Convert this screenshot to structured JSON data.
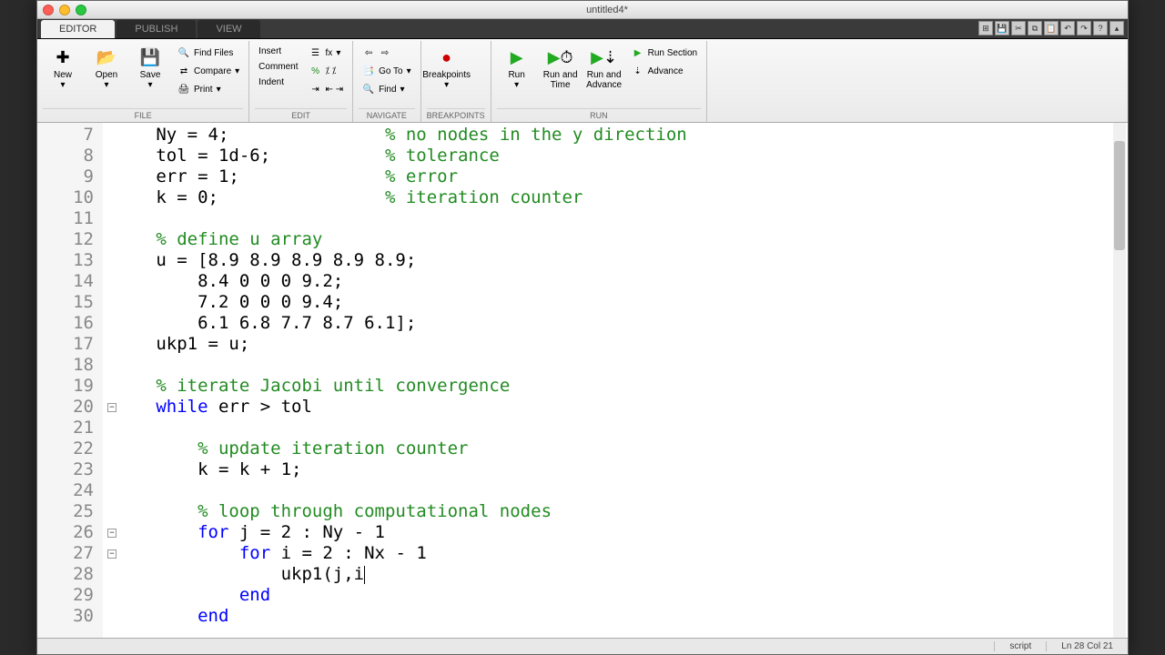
{
  "window": {
    "title": "untitled4*"
  },
  "tabs": {
    "editor": "EDITOR",
    "publish": "PUBLISH",
    "view": "VIEW"
  },
  "ribbon": {
    "file": {
      "label": "FILE",
      "new": "New",
      "open": "Open",
      "save": "Save",
      "find_files": "Find Files",
      "compare": "Compare",
      "print": "Print"
    },
    "edit": {
      "label": "EDIT",
      "insert": "Insert",
      "comment": "Comment",
      "indent": "Indent",
      "fx": "fx"
    },
    "nav": {
      "label": "NAVIGATE",
      "goto": "Go To",
      "find": "Find"
    },
    "bp": {
      "label": "BREAKPOINTS",
      "breakpoints": "Breakpoints"
    },
    "run": {
      "label": "RUN",
      "run": "Run",
      "run_time": "Run and Time",
      "run_adv": "Run and Advance",
      "run_section": "Run Section",
      "advance": "Advance"
    }
  },
  "code_lines": [
    {
      "n": 7,
      "segs": [
        [
          "txt",
          "   Ny = 4;               "
        ],
        [
          "cm",
          "% no nodes in the y direction"
        ]
      ]
    },
    {
      "n": 8,
      "segs": [
        [
          "txt",
          "   tol = 1d-6;           "
        ],
        [
          "cm",
          "% tolerance"
        ]
      ]
    },
    {
      "n": 9,
      "segs": [
        [
          "txt",
          "   err = 1;              "
        ],
        [
          "cm",
          "% error"
        ]
      ]
    },
    {
      "n": 10,
      "segs": [
        [
          "txt",
          "   k = 0;                "
        ],
        [
          "cm",
          "% iteration counter"
        ]
      ]
    },
    {
      "n": 11,
      "segs": []
    },
    {
      "n": 12,
      "segs": [
        [
          "txt",
          "   "
        ],
        [
          "cm",
          "% define u array"
        ]
      ]
    },
    {
      "n": 13,
      "segs": [
        [
          "txt",
          "   u = [8.9 8.9 8.9 8.9 8.9;"
        ]
      ]
    },
    {
      "n": 14,
      "segs": [
        [
          "txt",
          "       8.4 0 0 0 9.2;"
        ]
      ]
    },
    {
      "n": 15,
      "segs": [
        [
          "txt",
          "       7.2 0 0 0 9.4;"
        ]
      ]
    },
    {
      "n": 16,
      "segs": [
        [
          "txt",
          "       6.1 6.8 7.7 8.7 6.1];"
        ]
      ]
    },
    {
      "n": 17,
      "segs": [
        [
          "txt",
          "   ukp1 = u;"
        ]
      ]
    },
    {
      "n": 18,
      "segs": []
    },
    {
      "n": 19,
      "segs": [
        [
          "txt",
          "   "
        ],
        [
          "cm",
          "% iterate Jacobi until convergence"
        ]
      ]
    },
    {
      "n": 20,
      "fold": "-",
      "segs": [
        [
          "txt",
          "   "
        ],
        [
          "kw",
          "while"
        ],
        [
          "txt",
          " err > tol"
        ]
      ]
    },
    {
      "n": 21,
      "segs": []
    },
    {
      "n": 22,
      "segs": [
        [
          "txt",
          "       "
        ],
        [
          "cm",
          "% update iteration counter"
        ]
      ]
    },
    {
      "n": 23,
      "segs": [
        [
          "txt",
          "       k = k + 1;"
        ]
      ]
    },
    {
      "n": 24,
      "segs": []
    },
    {
      "n": 25,
      "segs": [
        [
          "txt",
          "       "
        ],
        [
          "cm",
          "% loop through computational nodes"
        ]
      ]
    },
    {
      "n": 26,
      "fold": "-",
      "segs": [
        [
          "txt",
          "       "
        ],
        [
          "kw",
          "for"
        ],
        [
          "txt",
          " j = 2 : Ny - 1"
        ]
      ]
    },
    {
      "n": 27,
      "fold": "-",
      "segs": [
        [
          "txt",
          "           "
        ],
        [
          "kw",
          "for"
        ],
        [
          "txt",
          " i = 2 : Nx - 1"
        ]
      ]
    },
    {
      "n": 28,
      "caret": true,
      "segs": [
        [
          "txt",
          "               ukp1(j,i"
        ]
      ]
    },
    {
      "n": 29,
      "segs": [
        [
          "txt",
          "           "
        ],
        [
          "kw",
          "end"
        ]
      ]
    },
    {
      "n": 30,
      "segs": [
        [
          "txt",
          "       "
        ],
        [
          "kw",
          "end"
        ]
      ]
    }
  ],
  "status": {
    "mode": "script",
    "pos": "Ln  28   Col  21"
  }
}
